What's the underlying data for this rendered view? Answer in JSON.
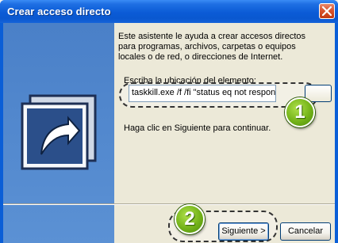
{
  "window": {
    "title": "Crear acceso directo"
  },
  "intro_text": "Este asistente le ayuda a crear accesos directos para programas, archivos, carpetas o equipos locales o de red, o direcciones de Internet.",
  "location": {
    "label": "Escriba la ubicación del elemento:",
    "value": "taskkill.exe /f /fi \"status eq not responc"
  },
  "hint_text": "Haga clic en Siguiente para continuar.",
  "buttons": {
    "next": "Siguiente >",
    "cancel": "Cancelar"
  },
  "badges": {
    "one": "1",
    "two": "2"
  },
  "colors": {
    "titlebar": "#0a58d0",
    "banner": "#5b91d4",
    "badge": "#74b319",
    "close": "#c23a12"
  }
}
